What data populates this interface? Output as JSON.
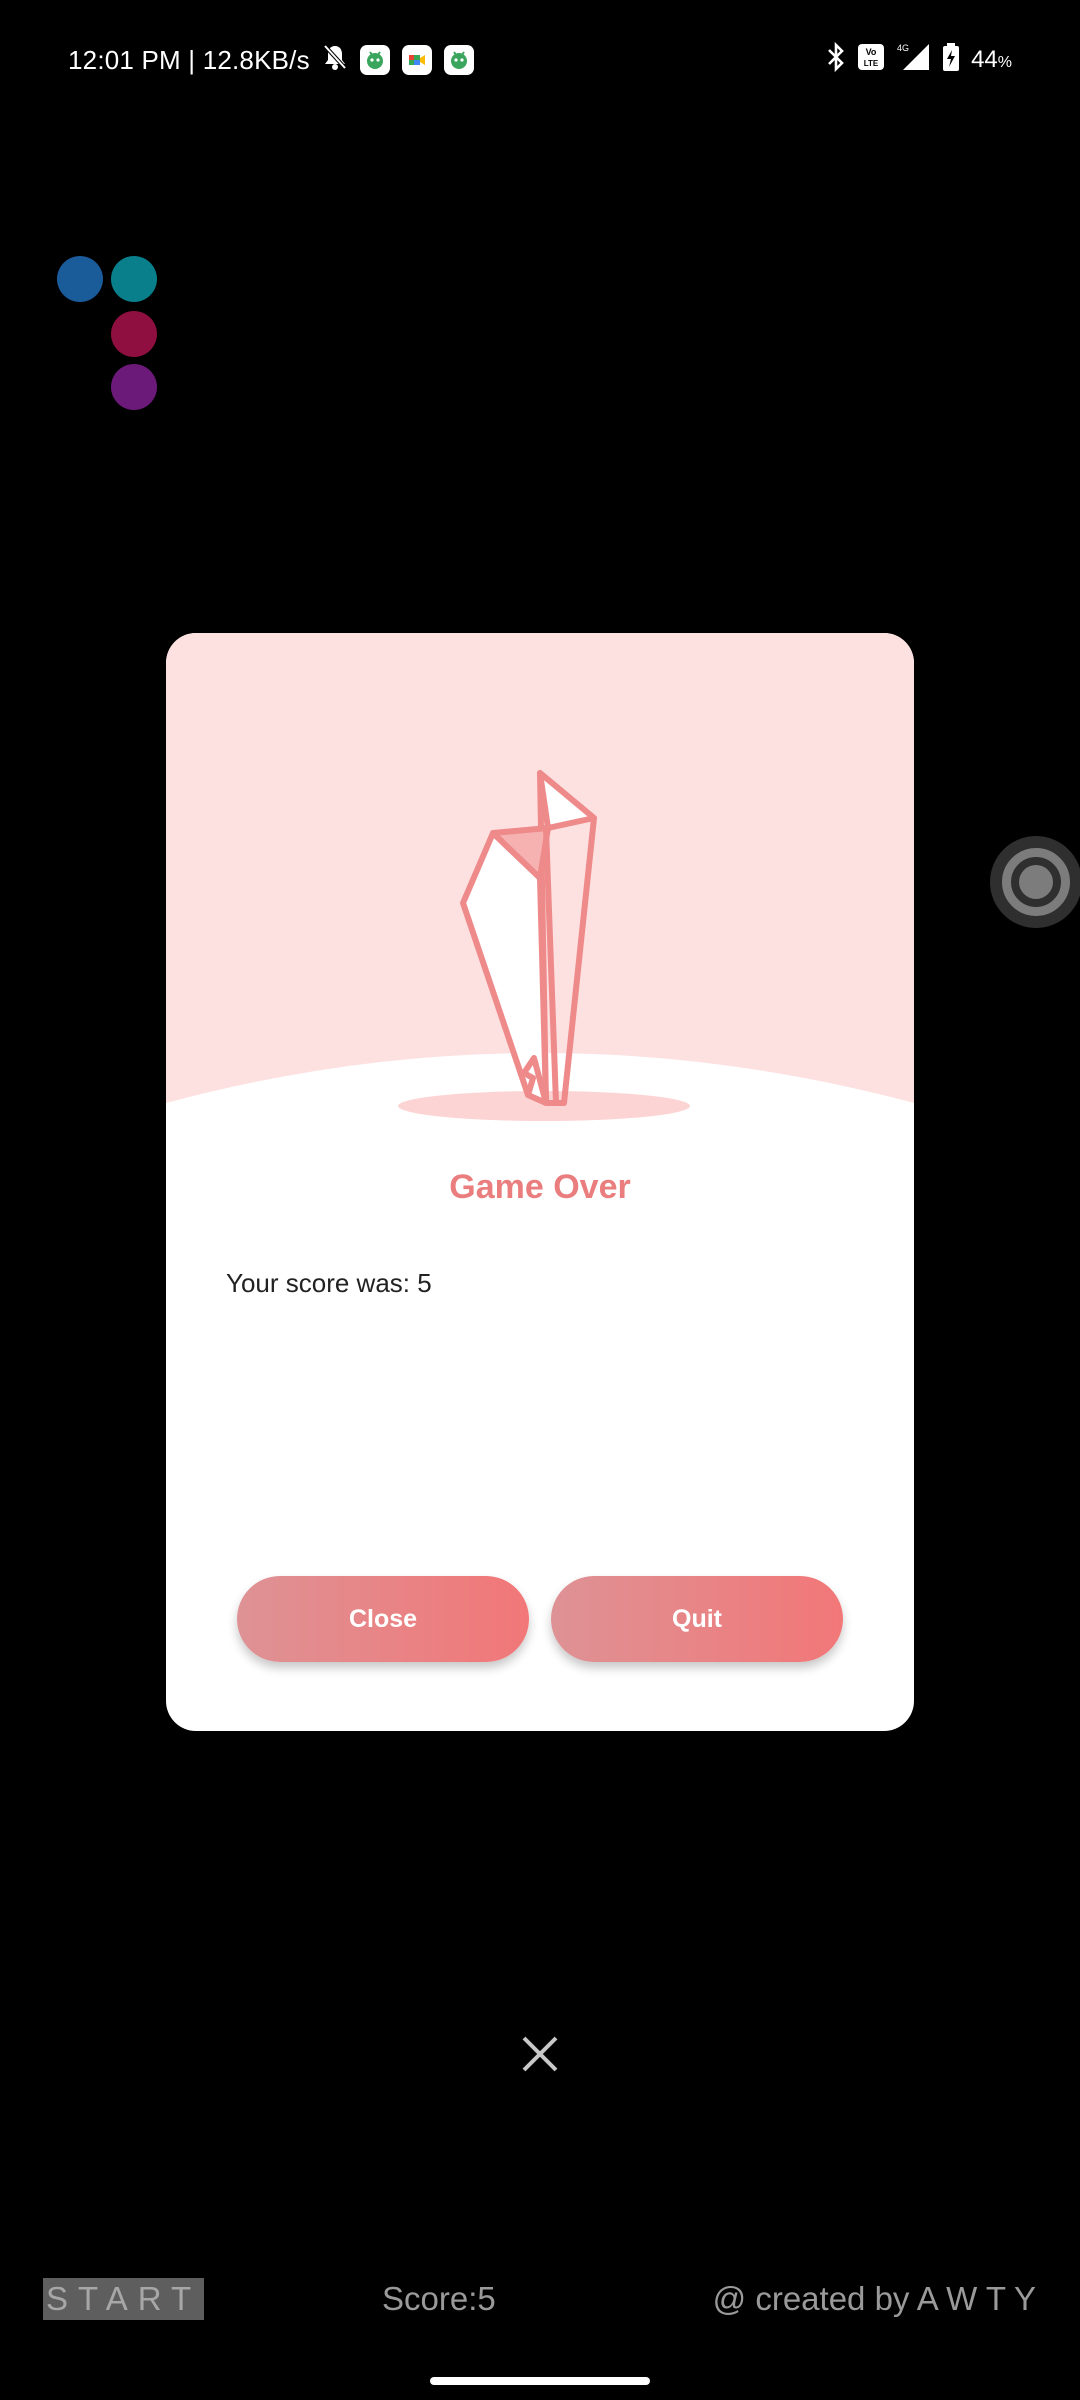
{
  "status_bar": {
    "time_speed": "12:01 PM | 12.8KB/s",
    "battery_level": "44",
    "battery_unit": "%",
    "network": "4G",
    "volte": "Vo LTE",
    "icons": [
      "silent-bell-icon",
      "app-notification-icon",
      "meet-notification-icon",
      "app-notification-icon",
      "bluetooth-icon",
      "volte-icon",
      "signal-icon",
      "battery-icon"
    ]
  },
  "dots": [
    {
      "name": "dot-blue",
      "color": "#1a5b9a"
    },
    {
      "name": "dot-teal",
      "color": "#0a7f8c"
    },
    {
      "name": "dot-crimson",
      "color": "#8f1040"
    },
    {
      "name": "dot-purple",
      "color": "#6b1a7a"
    }
  ],
  "dialog": {
    "title": "Game Over",
    "message": "Your score was: 5",
    "close_label": "Close",
    "quit_label": "Quit",
    "hero_bg_color": "#fde1e1",
    "accent_color": "#ea7e7e"
  },
  "bottom_bar": {
    "start_label": "START",
    "score_label": "Score:5",
    "credit": "@ created by A W T Y"
  }
}
